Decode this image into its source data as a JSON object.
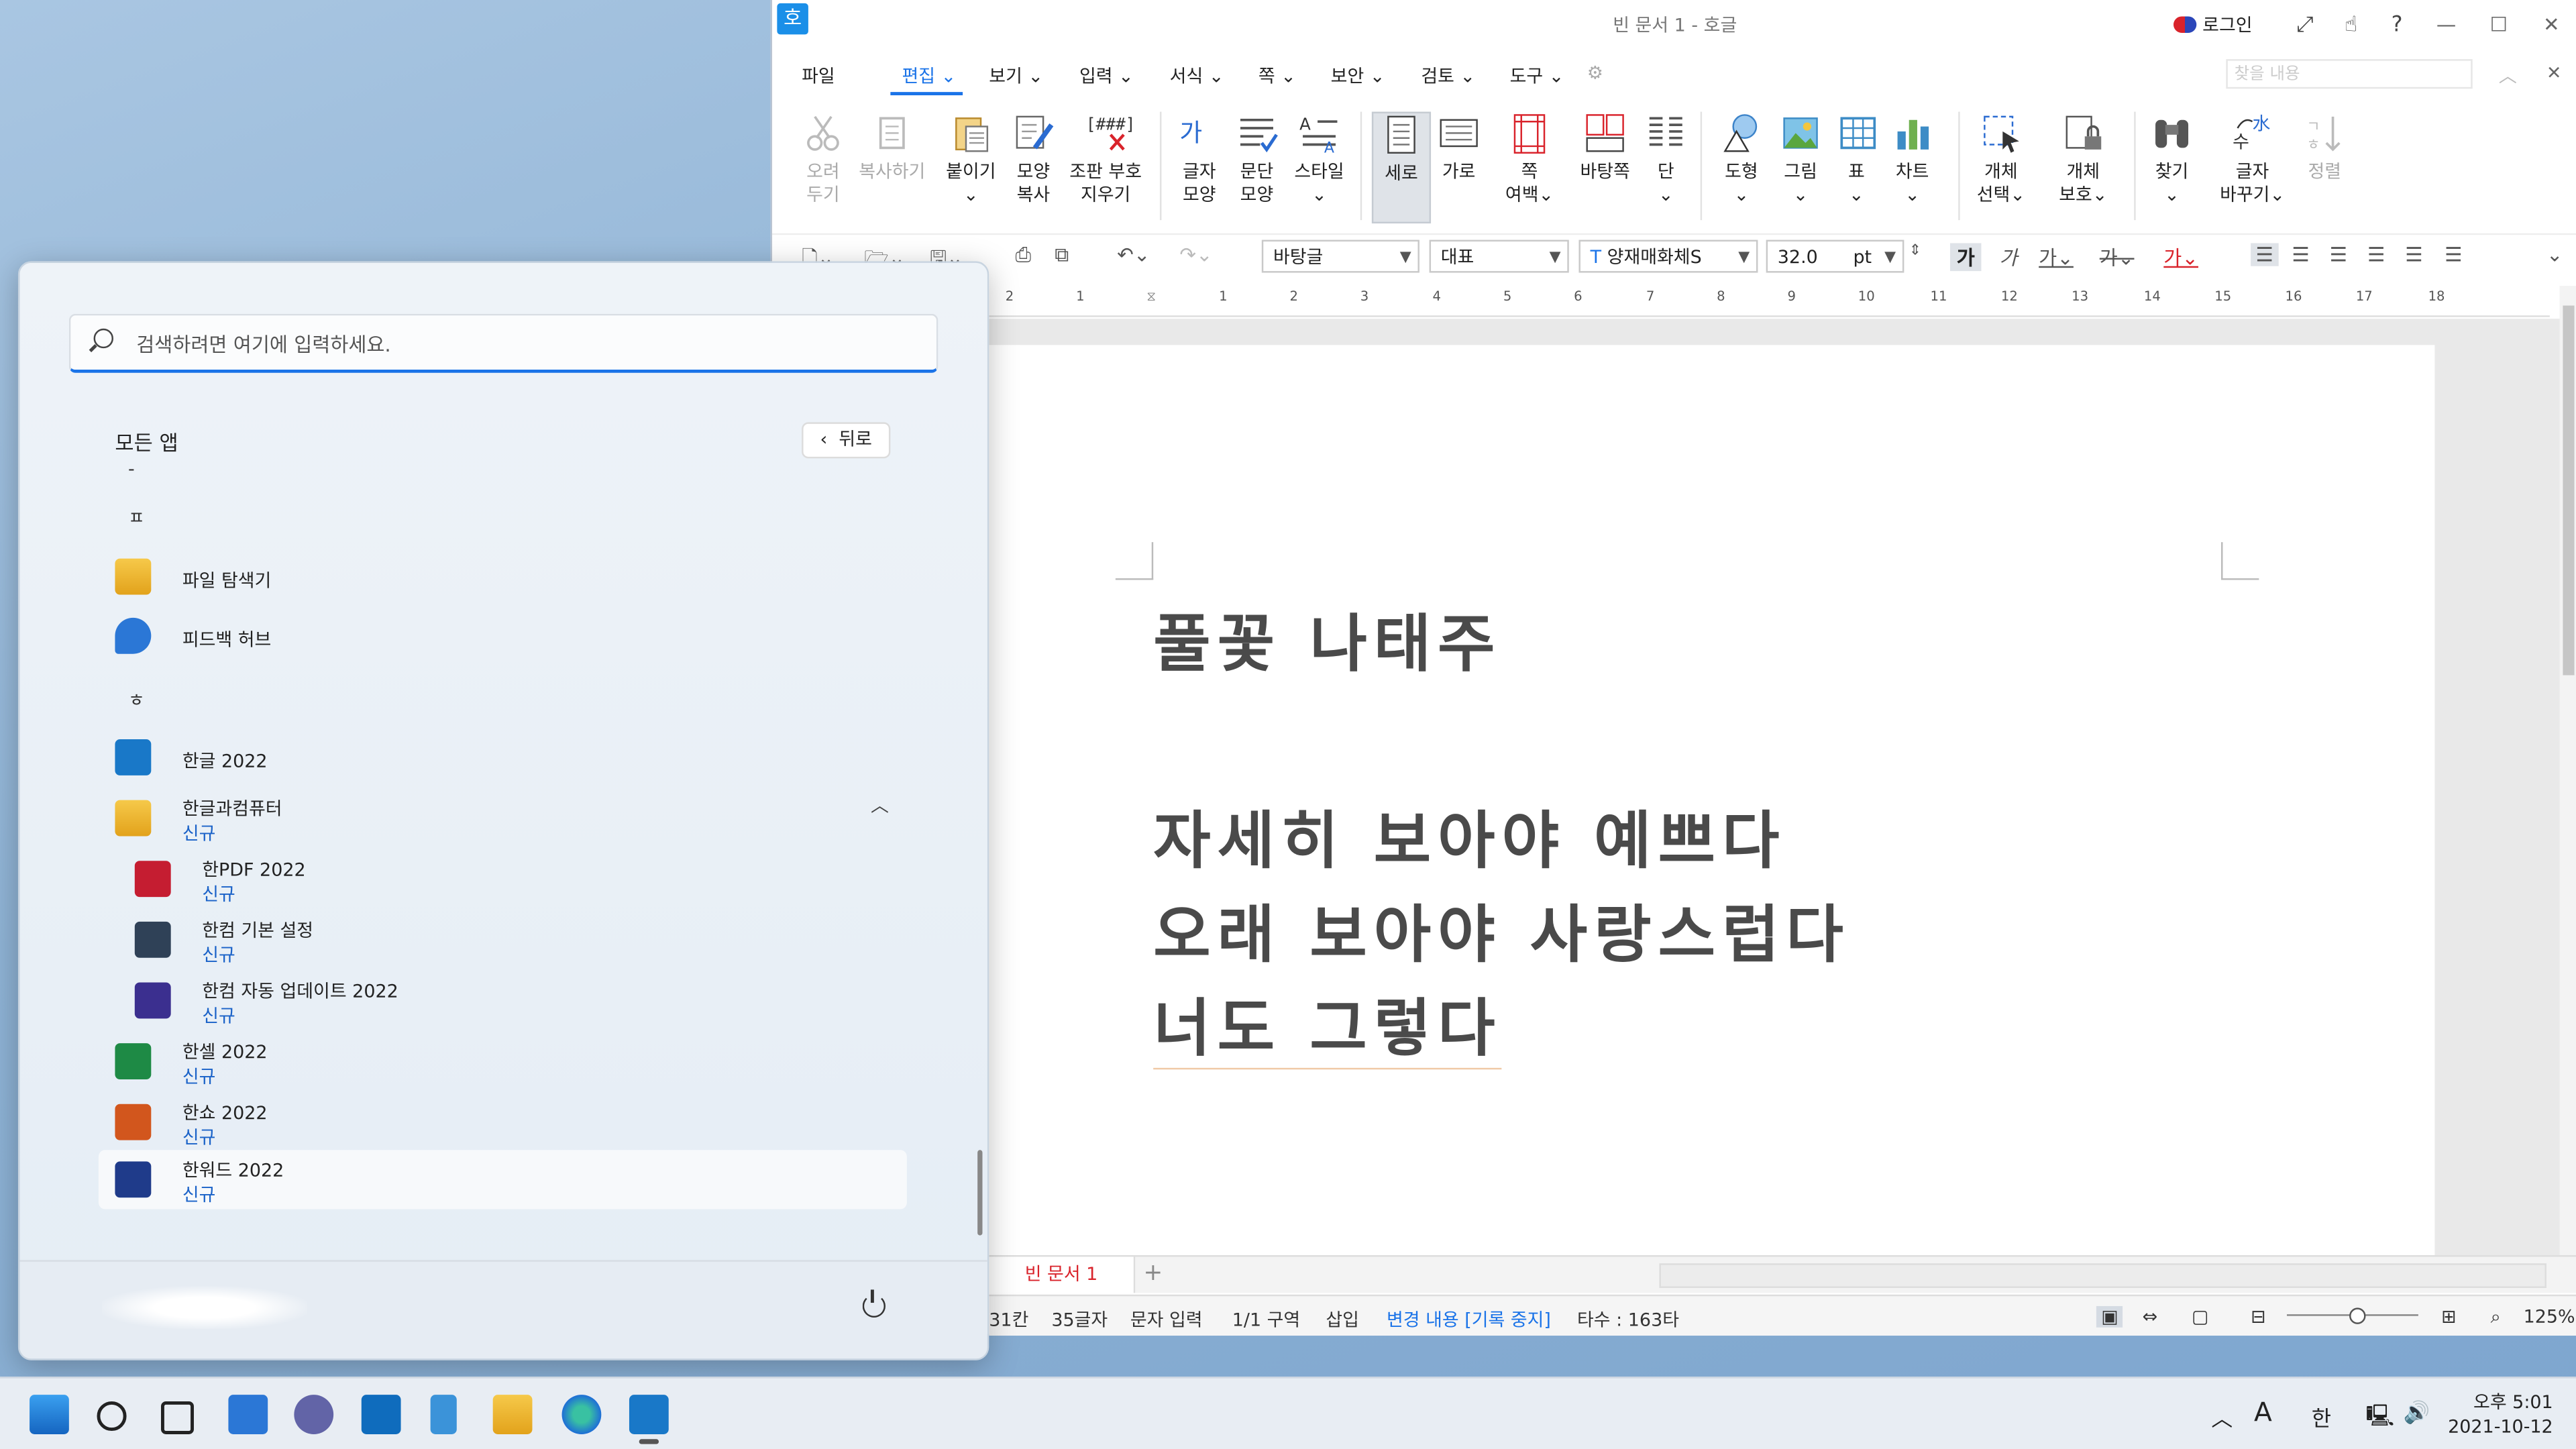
{
  "hwp": {
    "title": "빈 문서 1 - 호글",
    "app_logo": "호",
    "login": "로그인",
    "menu": [
      "파일",
      "편집",
      "보기",
      "입력",
      "서식",
      "쪽",
      "보안",
      "검토",
      "도구"
    ],
    "menu_search_placeholder": "찾을 내용",
    "ribbon": [
      {
        "l1": "오려",
        "l2": "두기"
      },
      {
        "l1": "복사하기",
        "l2": ""
      },
      {
        "l1": "붙이기",
        "l2": ""
      },
      {
        "l1": "모양",
        "l2": "복사"
      },
      {
        "l1": "조판 부호",
        "l2": "지우기"
      },
      {
        "l1": "글자",
        "l2": "모양"
      },
      {
        "l1": "문단",
        "l2": "모양"
      },
      {
        "l1": "스타일",
        "l2": ""
      },
      {
        "l1": "세로",
        "l2": ""
      },
      {
        "l1": "가로",
        "l2": ""
      },
      {
        "l1": "쪽",
        "l2": "여백"
      },
      {
        "l1": "바탕쪽",
        "l2": ""
      },
      {
        "l1": "단",
        "l2": ""
      },
      {
        "l1": "도형",
        "l2": ""
      },
      {
        "l1": "그림",
        "l2": ""
      },
      {
        "l1": "표",
        "l2": ""
      },
      {
        "l1": "차트",
        "l2": ""
      },
      {
        "l1": "개체",
        "l2": "선택"
      },
      {
        "l1": "개체",
        "l2": "보호"
      },
      {
        "l1": "찾기",
        "l2": ""
      },
      {
        "l1": "글자",
        "l2": "바꾸기"
      },
      {
        "l1": "정렬",
        "l2": ""
      }
    ],
    "style_combo": "바탕글",
    "lang_combo": "대표",
    "font_combo": "양재매화체S",
    "size_value": "32.0",
    "size_unit": "pt",
    "ruler_ticks": [
      "2",
      "1",
      "1",
      "2",
      "3",
      "4",
      "5",
      "6",
      "7",
      "8",
      "9",
      "10",
      "11",
      "12",
      "13",
      "14",
      "15",
      "16",
      "17",
      "18"
    ],
    "doc_lines": [
      "풀꽃 나태주",
      "자세히 보아야 예쁘다",
      "오래 보아야 사랑스럽다",
      "너도 그렇다"
    ],
    "doc_tab": "빈 문서 1",
    "status": {
      "line": "31칸",
      "chars": "35글자",
      "mode": "문자 입력",
      "section": "1/1 구역",
      "insert": "삽입",
      "track": "변경 내용 [기록 중지]",
      "strokes": "타수 : 163타",
      "zoom": "125%"
    }
  },
  "start_menu": {
    "search_placeholder": "검색하려면 여기에 입력하세요.",
    "all_apps": "모든 앱",
    "back": "뒤로",
    "letters": [
      "-",
      "ㅍ",
      "ㅎ"
    ],
    "apps": [
      {
        "name": "파일 탐색기",
        "tag": ""
      },
      {
        "name": "피드백 허브",
        "tag": ""
      },
      {
        "name": "한글 2022",
        "tag": ""
      },
      {
        "name": "한글과컴퓨터",
        "tag": "신규"
      },
      {
        "name": "한PDF 2022",
        "tag": "신규"
      },
      {
        "name": "한컴 기본 설정",
        "tag": "신규"
      },
      {
        "name": "한컴 자동 업데이트 2022",
        "tag": "신규"
      },
      {
        "name": "한셀 2022",
        "tag": "신규"
      },
      {
        "name": "한쇼 2022",
        "tag": "신규"
      },
      {
        "name": "한워드 2022",
        "tag": "신규"
      }
    ]
  },
  "taskbar": {
    "ime_mode": "A",
    "ime_lang": "한",
    "time": "오후 5:01",
    "date": "2021-10-12"
  },
  "colors": {
    "accent": "#1a73e8",
    "hwp_red": "#d9232b"
  }
}
